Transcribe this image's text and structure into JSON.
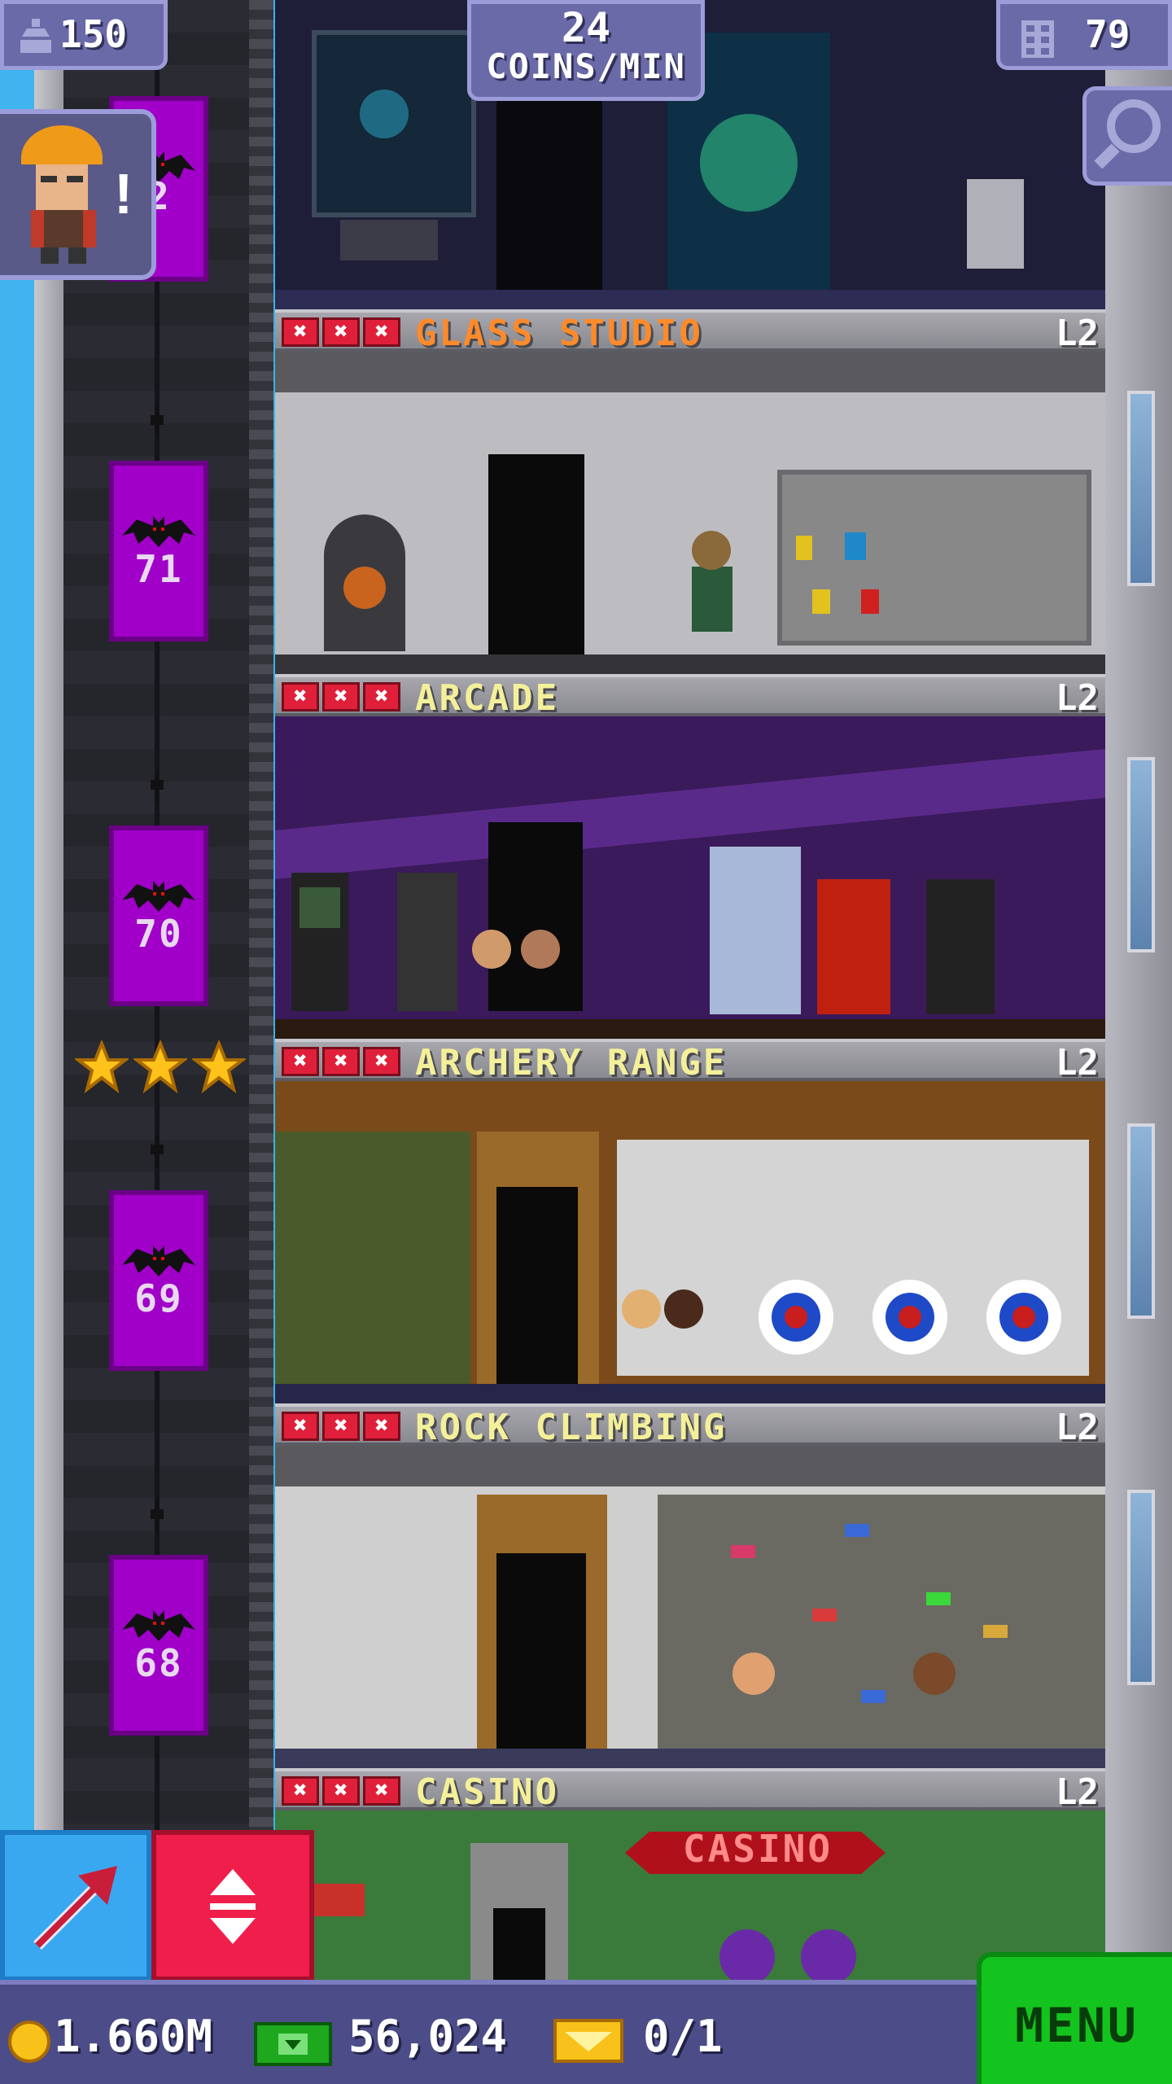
{
  "hud": {
    "population": "150",
    "coins_per_min_value": "24",
    "coins_per_min_label": "COINS/MIN",
    "floor_count": "79"
  },
  "elevators": [
    {
      "floor": "2"
    },
    {
      "floor": "71"
    },
    {
      "floor": "70"
    },
    {
      "floor": "69"
    },
    {
      "floor": "68"
    }
  ],
  "floors": [
    {
      "name": "GLASS STUDIO",
      "level": "L2"
    },
    {
      "name": "ARCADE",
      "level": "L2"
    },
    {
      "name": "ARCHERY RANGE",
      "level": "L2"
    },
    {
      "name": "ROCK CLIMBING",
      "level": "L2"
    },
    {
      "name": "CASINO",
      "level": "L2"
    }
  ],
  "casino_sign": "CASINO",
  "stock_marker": "✖",
  "bottom_bar": {
    "coins": "1.660M",
    "bux": "56,024",
    "tickets": "0/1",
    "menu_label": "MENU"
  },
  "icons": {
    "population": "population-icon",
    "floors": "building-icon",
    "zoom": "magnifier-icon",
    "builder": "builder-avatar-icon",
    "build": "build-arrow-icon",
    "elevator": "elevator-updown-icon",
    "coin": "coin-icon",
    "bux": "bux-icon",
    "ticket": "golden-ticket-icon",
    "star": "star-icon"
  },
  "colors": {
    "hud_bg": "#6a6aa8",
    "elevator": "#a000c8",
    "menu_green": "#14c41e",
    "elevator_button_red": "#f01e4a",
    "build_button_blue": "#3aa8f0",
    "stock_x_red": "#e0203a",
    "label_yellow": "#f4f09a",
    "label_orange": "#ff8a2a"
  },
  "glass_studio_warning": true,
  "elevator_star_rating": 3
}
